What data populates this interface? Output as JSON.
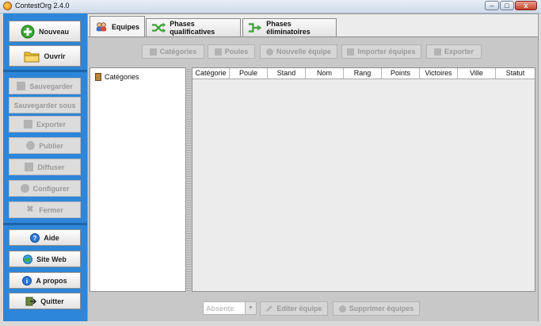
{
  "window": {
    "title": "ContestOrg 2.4.0",
    "buttons": {
      "minimize": "–",
      "maximize": "□",
      "close": "x"
    }
  },
  "sidebar": {
    "primary": [
      {
        "label": "Nouveau",
        "icon": "add-circle-icon",
        "color": "#3aa835"
      },
      {
        "label": "Ouvrir",
        "icon": "folder-icon",
        "color": "#f1c232"
      }
    ],
    "file_actions": [
      {
        "label": "Sauvegarder",
        "icon": "save-icon"
      },
      {
        "label": "Sauvegarder sous"
      },
      {
        "label": "Exporter",
        "icon": "export-icon"
      },
      {
        "label": "Publier",
        "icon": "publish-icon"
      },
      {
        "label": "Diffuser",
        "icon": "broadcast-icon"
      },
      {
        "label": "Configurer",
        "icon": "gear-icon"
      },
      {
        "label": "Fermer",
        "icon": "close-icon"
      }
    ],
    "help": [
      {
        "label": "Aide",
        "icon": "help-icon"
      },
      {
        "label": "Site Web",
        "icon": "globe-icon"
      },
      {
        "label": "A propos",
        "icon": "info-icon"
      },
      {
        "label": "Quitter",
        "icon": "exit-icon"
      }
    ]
  },
  "tabs": [
    {
      "label": "Equipes",
      "icon": "teams-icon",
      "active": true
    },
    {
      "label": "Phases qualificatives",
      "icon": "shuffle-icon"
    },
    {
      "label": "Phases éliminatoires",
      "icon": "bracket-icon"
    }
  ],
  "toolbar": {
    "categories": "Catégories",
    "poules": "Poules",
    "nouvelle_equipe": "Nouvelle équipe",
    "importer": "Importer équipes",
    "exporter": "Exporter"
  },
  "tree": {
    "root": "Catégories"
  },
  "table": {
    "columns": [
      "Catégorie",
      "Poule",
      "Stand",
      "Nom",
      "Rang",
      "Points",
      "Victoires",
      "Ville",
      "Statut"
    ],
    "rows": []
  },
  "bottom": {
    "status_select": "Absente",
    "edit": "Editer équipe",
    "delete": "Supprimer équipes"
  }
}
